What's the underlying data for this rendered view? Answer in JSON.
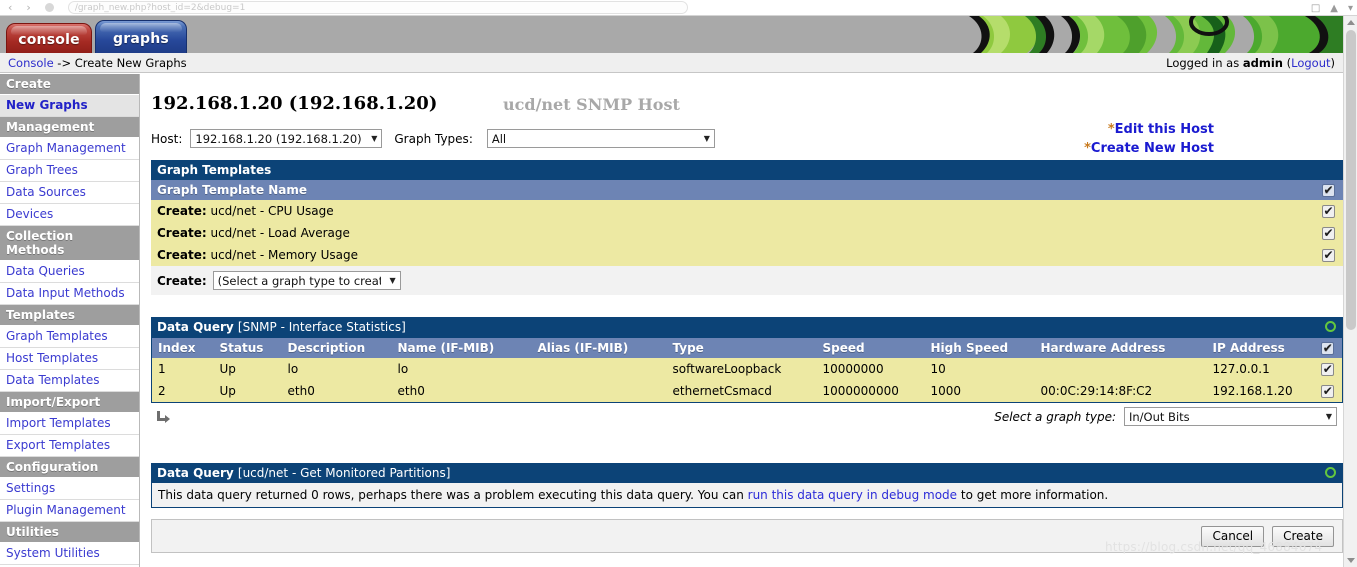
{
  "browser": {
    "url_text": "/graph_new.php?host_id=2&debug=1",
    "minimize_icon": "minimize-icon",
    "maximize_icon": "maximize-icon",
    "close_icon": "close-icon"
  },
  "banner": {
    "tabs": [
      {
        "label": "console",
        "name": "tab-console",
        "active": false
      },
      {
        "label": "graphs",
        "name": "tab-graphs",
        "active": true
      }
    ],
    "logo_art": "cacti-leaf-banner"
  },
  "breadcrumb": {
    "root_link": "Console",
    "separator": " -> ",
    "current": "Create New Graphs",
    "logged_in_prefix": "Logged in as ",
    "user": "admin",
    "logout_open": " (",
    "logout_label": "Logout",
    "logout_close": ")"
  },
  "sidebar": {
    "sections": [
      {
        "header": "Create",
        "items": [
          {
            "label": "New Graphs",
            "selected": true
          }
        ]
      },
      {
        "header": "Management",
        "items": [
          {
            "label": "Graph Management",
            "selected": false
          },
          {
            "label": "Graph Trees",
            "selected": false
          },
          {
            "label": "Data Sources",
            "selected": false
          },
          {
            "label": "Devices",
            "selected": false
          }
        ]
      },
      {
        "header": "Collection Methods",
        "items": [
          {
            "label": "Data Queries",
            "selected": false
          },
          {
            "label": "Data Input Methods",
            "selected": false
          }
        ]
      },
      {
        "header": "Templates",
        "items": [
          {
            "label": "Graph Templates",
            "selected": false
          },
          {
            "label": "Host Templates",
            "selected": false
          },
          {
            "label": "Data Templates",
            "selected": false
          }
        ]
      },
      {
        "header": "Import/Export",
        "items": [
          {
            "label": "Import Templates",
            "selected": false
          },
          {
            "label": "Export Templates",
            "selected": false
          }
        ]
      },
      {
        "header": "Configuration",
        "items": [
          {
            "label": "Settings",
            "selected": false
          },
          {
            "label": "Plugin Management",
            "selected": false
          }
        ]
      },
      {
        "header": "Utilities",
        "items": [
          {
            "label": "System Utilities",
            "selected": false
          }
        ]
      }
    ]
  },
  "main": {
    "title": "192.168.1.20 (192.168.1.20)",
    "subtitle": "ucd/net SNMP Host",
    "host_label": "Host:",
    "host_value": "192.168.1.20 (192.168.1.20)",
    "graph_types_label": "Graph Types:",
    "graph_types_value": "All",
    "host_links": [
      {
        "star": "*",
        "label": "Edit this Host"
      },
      {
        "star": "*",
        "label": "Create New Host"
      }
    ],
    "graph_templates": {
      "section_title": "Graph Templates",
      "column_header": "Graph Template Name",
      "header_checkbox_checked": true,
      "rows": [
        {
          "prefix": "Create:",
          "name": "ucd/net - CPU Usage",
          "checked": true
        },
        {
          "prefix": "Create:",
          "name": "ucd/net - Load Average",
          "checked": true
        },
        {
          "prefix": "Create:",
          "name": "ucd/net - Memory Usage",
          "checked": true
        }
      ],
      "create_label": "Create:",
      "create_select_value": "(Select a graph type to create)"
    },
    "data_query_snmp": {
      "section_label": "Data Query",
      "section_target": "[SNMP - Interface Statistics]",
      "refresh_icon": "green-circle-refresh-icon",
      "columns": [
        "Index",
        "Status",
        "Description",
        "Name (IF-MIB)",
        "Alias (IF-MIB)",
        "Type",
        "Speed",
        "High Speed",
        "Hardware Address",
        "IP Address"
      ],
      "header_checkbox_checked": true,
      "rows": [
        {
          "cells": [
            "1",
            "Up",
            "lo",
            "lo",
            "",
            "softwareLoopback",
            "10000000",
            "10",
            "",
            "127.0.0.1"
          ],
          "checked": true
        },
        {
          "cells": [
            "2",
            "Up",
            "eth0",
            "eth0",
            "",
            "ethernetCsmacd",
            "1000000000",
            "1000",
            "00:0C:29:14:8F:C2",
            "192.168.1.20"
          ],
          "checked": true
        }
      ],
      "footer_arrow_icon": "sub-arrow-icon",
      "graph_type_label": "Select a graph type:",
      "graph_type_value": "In/Out Bits"
    },
    "data_query_partitions": {
      "section_label": "Data Query",
      "section_target": "[ucd/net - Get Monitored Partitions]",
      "refresh_icon": "green-circle-refresh-icon",
      "message_before": "This data query returned 0 rows, perhaps there was a problem executing this data query. You can ",
      "message_link": "run this data query in debug mode",
      "message_after": " to get more information."
    },
    "buttons": {
      "cancel": "Cancel",
      "create": "Create"
    }
  },
  "watermark": "https://blog.csdn.net/qq_46884674",
  "colors": {
    "section_header": "#0c4377",
    "column_header": "#6d84b4",
    "row_yellow": "#ede9a3",
    "link_blue": "#2c2ccc",
    "tab_console_red": "#a52a23",
    "tab_graphs_blue": "#27489a",
    "refresh_green": "#63c63f",
    "star_orange": "#c87a1e"
  }
}
